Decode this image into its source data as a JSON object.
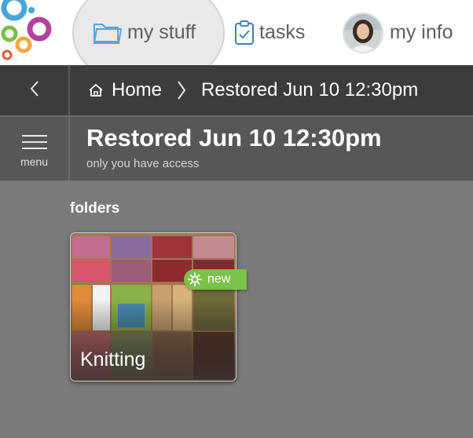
{
  "nav": {
    "tabs": [
      {
        "label": "my stuff",
        "icon": "folder-icon",
        "active": true
      },
      {
        "label": "tasks",
        "icon": "clipboard-check-icon",
        "active": false
      },
      {
        "label": "my info",
        "icon": "avatar",
        "active": false
      }
    ]
  },
  "breadcrumb": {
    "home_label": "Home",
    "current": "Restored Jun 10 12:30pm"
  },
  "header": {
    "menu_label": "menu",
    "title": "Restored Jun 10 12:30pm",
    "access": "only you have access"
  },
  "content": {
    "section_label": "folders",
    "folders": [
      {
        "name": "Knitting",
        "badge": "new"
      }
    ]
  },
  "colors": {
    "accent_blue": "#5aa6d8",
    "badge_green": "#7cc14a",
    "content_bg": "#7a7a7a"
  }
}
